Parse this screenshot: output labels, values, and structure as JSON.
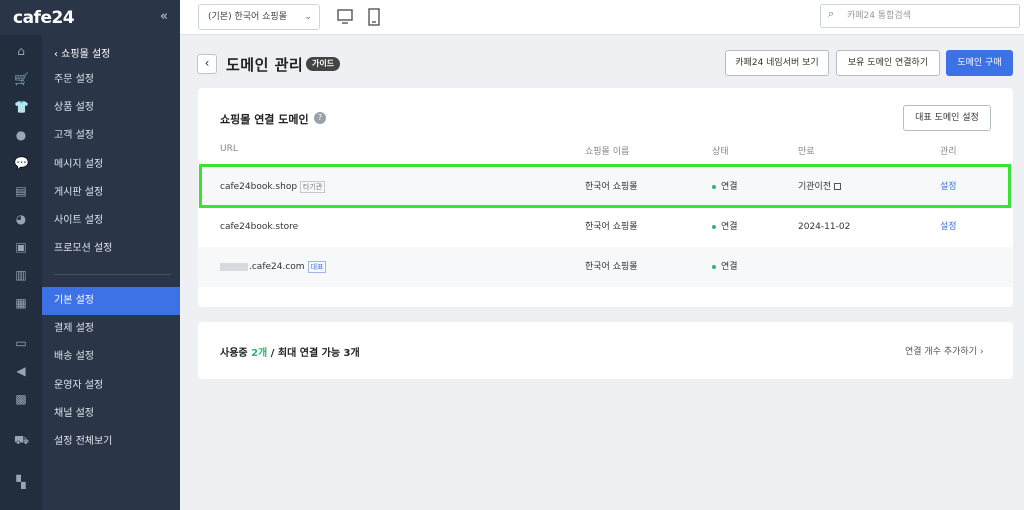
{
  "brand": {
    "logo": "cafe24",
    "collapse": "«"
  },
  "sidebar": {
    "header": "‹ 쇼핑몰 설정",
    "items": [
      {
        "label": "주문 설정"
      },
      {
        "label": "상품 설정"
      },
      {
        "label": "고객 설정"
      },
      {
        "label": "메시지 설정"
      },
      {
        "label": "게시판 설정"
      },
      {
        "label": "사이트 설정"
      },
      {
        "label": "프로모션 설정"
      },
      {
        "label": "기본 설정"
      },
      {
        "label": "결제 설정"
      },
      {
        "label": "배송 설정"
      },
      {
        "label": "운영자 설정"
      },
      {
        "label": "채널 설정"
      },
      {
        "label": "설정 전체보기"
      }
    ],
    "active": "기본 설정",
    "rail_icons": [
      "home-icon",
      "cart-icon",
      "shirt-icon",
      "user-icon",
      "chat-icon",
      "board-icon",
      "palette-icon",
      "coupon-icon",
      "chart-icon",
      "book-icon",
      "box-icon",
      "megaphone-icon",
      "store-icon",
      "truck-icon",
      "apps-icon"
    ]
  },
  "topbar": {
    "shop_select": "(기본) 한국어 쇼핑몰",
    "search_placeholder": "카페24 통합검색"
  },
  "page": {
    "title": "도메인 관리",
    "guide_badge": "가이드",
    "buttons": {
      "nameserver": "카페24 네임서버 보기",
      "connect": "보유 도메인 연결하기",
      "buy": "도메인 구매"
    }
  },
  "card": {
    "title": "쇼핑몰 연결 도메인",
    "help": "?",
    "rep_button": "대표 도메인 설정",
    "columns": {
      "url": "URL",
      "shop": "쇼핑몰 이름",
      "status": "상태",
      "expire": "만료",
      "manage": "관리"
    },
    "rows": [
      {
        "url": "cafe24book.shop",
        "tag": "타기관",
        "shop": "한국어 쇼핑몰",
        "status": "연결",
        "expire": "기관이전",
        "manage": "설정"
      },
      {
        "url": "cafe24book.store",
        "tag": "",
        "shop": "한국어 쇼핑몰",
        "status": "연결",
        "expire": "2024-11-02",
        "manage": "설정"
      },
      {
        "url": ".cafe24.com",
        "tag": "대표",
        "shop": "한국어 쇼핑몰",
        "status": "연결",
        "expire": "",
        "manage": ""
      }
    ]
  },
  "usage": {
    "prefix": "사용중",
    "count": "2개",
    "suffix": "/ 최대 연결 가능 3개",
    "add_link": "연결 개수 추가하기 ›"
  },
  "colors": {
    "accent": "#3d72e6",
    "status_green": "#2bb673",
    "highlight": "#39e233",
    "sidebar_bg": "#2a3548"
  }
}
